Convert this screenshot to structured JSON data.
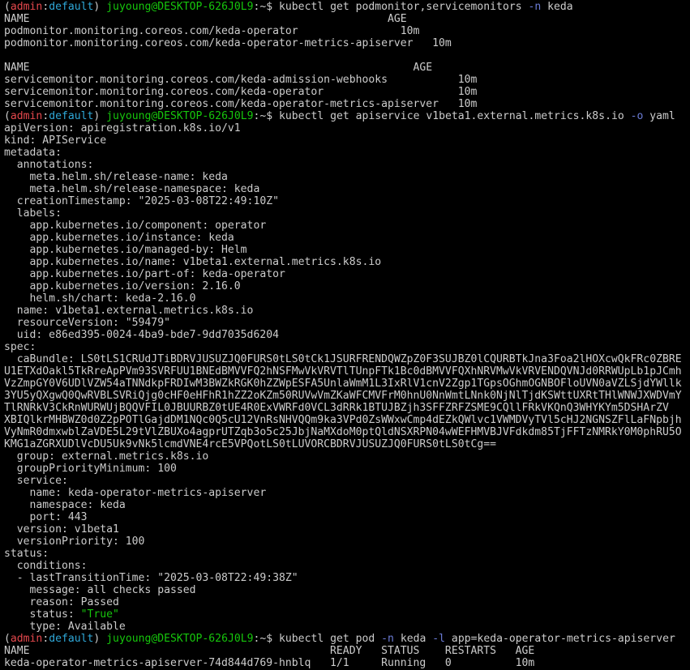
{
  "colors": {
    "background": "#000000",
    "foreground": "#cccccc",
    "prompt_env": "#e5484d",
    "prompt_ctx": "#2fa8d8",
    "prompt_user": "#16c60c",
    "flag": "#6b7cd6",
    "value_true": "#16c60c"
  },
  "lines": [
    {
      "kind": "prompt",
      "env": "admin",
      "ctx": "default",
      "userhost": "juyoung@DESKTOP-626J0L9",
      "path": ":~$ ",
      "cmd": [
        {
          "t": "kubectl get podmonitor,servicemonitors "
        },
        {
          "t": "-n",
          "c": "flag"
        },
        {
          "t": " keda"
        }
      ]
    },
    {
      "kind": "out",
      "text": "NAME                                                        AGE"
    },
    {
      "kind": "out",
      "text": "podmonitor.monitoring.coreos.com/keda-operator                10m"
    },
    {
      "kind": "out",
      "text": "podmonitor.monitoring.coreos.com/keda-operator-metrics-apiserver   10m"
    },
    {
      "kind": "out",
      "text": ""
    },
    {
      "kind": "out",
      "text": "NAME                                                            AGE"
    },
    {
      "kind": "out",
      "text": "servicemonitor.monitoring.coreos.com/keda-admission-webhooks           10m"
    },
    {
      "kind": "out",
      "text": "servicemonitor.monitoring.coreos.com/keda-operator                     10m"
    },
    {
      "kind": "out",
      "text": "servicemonitor.monitoring.coreos.com/keda-operator-metrics-apiserver   10m"
    },
    {
      "kind": "prompt",
      "env": "admin",
      "ctx": "default",
      "userhost": "juyoung@DESKTOP-626J0L9",
      "path": ":~$ ",
      "cmd": [
        {
          "t": "kubectl get apiservice v1beta1.external.metrics.k8s.io "
        },
        {
          "t": "-o",
          "c": "flag"
        },
        {
          "t": " yaml"
        }
      ]
    },
    {
      "kind": "out",
      "text": "apiVersion: apiregistration.k8s.io/v1"
    },
    {
      "kind": "out",
      "text": "kind: APIService"
    },
    {
      "kind": "out",
      "text": "metadata:"
    },
    {
      "kind": "out",
      "text": "  annotations:"
    },
    {
      "kind": "out",
      "text": "    meta.helm.sh/release-name: keda"
    },
    {
      "kind": "out",
      "text": "    meta.helm.sh/release-namespace: keda"
    },
    {
      "kind": "out",
      "text": "  creationTimestamp: \"2025-03-08T22:49:10Z\""
    },
    {
      "kind": "out",
      "text": "  labels:"
    },
    {
      "kind": "out",
      "text": "    app.kubernetes.io/component: operator"
    },
    {
      "kind": "out",
      "text": "    app.kubernetes.io/instance: keda"
    },
    {
      "kind": "out",
      "text": "    app.kubernetes.io/managed-by: Helm"
    },
    {
      "kind": "out",
      "text": "    app.kubernetes.io/name: v1beta1.external.metrics.k8s.io"
    },
    {
      "kind": "out",
      "text": "    app.kubernetes.io/part-of: keda-operator"
    },
    {
      "kind": "out",
      "text": "    app.kubernetes.io/version: 2.16.0"
    },
    {
      "kind": "out",
      "text": "    helm.sh/chart: keda-2.16.0"
    },
    {
      "kind": "out",
      "text": "  name: v1beta1.external.metrics.k8s.io"
    },
    {
      "kind": "out",
      "text": "  resourceVersion: \"59479\""
    },
    {
      "kind": "out",
      "text": "  uid: e86ed395-0024-4ba9-bde7-9dd7035d6204"
    },
    {
      "kind": "out",
      "text": "spec:"
    },
    {
      "kind": "out",
      "text": "  caBundle: LS0tLS1CRUdJTiBDRVJUSUZJQ0FURS0tLS0tCk1JSURFRENDQWZpZ0F3SUJBZ0lCQURBTkJna3Foa2lHOXcwQkFRc0ZBRE"
    },
    {
      "kind": "out",
      "text": "U1ETXdOakl5TkRreApPVm93SVRFUU1BNEdBMVVFQ2hNSFMwVkVRVTlTUnpFTk1Bc0dBMVVFQXhNRVMwVkVRVENDQVNJd0RRWUpLb1pJCmh"
    },
    {
      "kind": "out",
      "text": "VzZmpGY0V6UDlVZW54aTNNdkpFRDIwM3BWZkRGK0hZZWpESFA5UnlaWmM1L3IxRlV1cnV2Zgp1TGpsOGhmOGNBOFloUVN0aVZLSjdYWllk"
    },
    {
      "kind": "out",
      "text": "3YU5yQXgwQ0QwRVBLSVRiQjg0cHF0eHFhR1hZZ2oKZm50RUVwVmZKaWFCMVFrM0hnU0NnWmtLNnk0NjNlTjdKSWttUXRtTHlWNWJXWDVmY"
    },
    {
      "kind": "out",
      "text": "TlRNRkV3CkRnWURWUjBQQVFIL0JBUURBZ0tUE4R0ExVWRFd0VCL3dRRk1BTUJBZjh3SFFZRFZSME9CQllFRkVKQnQ3WHYKYm5DSHArZV"
    },
    {
      "kind": "out",
      "text": "XBIQlkrMHBWZ0d0Z2pPOTlGajdDM1NQc0Q5cU12VnRsNHVQQm9ka3VPd0ZsWWxwCmp4dEZkQWlvc1VWMDVyTVl5cHJ2NGNSZFlLaFNpbjh"
    },
    {
      "kind": "out",
      "text": "VyNmR0dmxwblZaVDE5L29tVlZBUXo4agprUTZqb3o5c25JbjNaMXdoM0ptQldNSXRPN04wWEFHMVBJVFdkdm85TjFFTzNMRkY0M0phRU5O"
    },
    {
      "kind": "out",
      "text": "KMG1aZGRXUDlVcDU5Uk9vNk5lcmdVNE4rcE5VPQotLS0tLUVORCBDRVJUSUZJQ0FURS0tLS0tCg=="
    },
    {
      "kind": "out",
      "text": "  group: external.metrics.k8s.io"
    },
    {
      "kind": "out",
      "text": "  groupPriorityMinimum: 100"
    },
    {
      "kind": "out",
      "text": "  service:"
    },
    {
      "kind": "out",
      "text": "    name: keda-operator-metrics-apiserver"
    },
    {
      "kind": "out",
      "text": "    namespace: keda"
    },
    {
      "kind": "out",
      "text": "    port: 443"
    },
    {
      "kind": "out",
      "text": "  version: v1beta1"
    },
    {
      "kind": "out",
      "text": "  versionPriority: 100"
    },
    {
      "kind": "out",
      "text": "status:"
    },
    {
      "kind": "out",
      "text": "  conditions:"
    },
    {
      "kind": "out",
      "text": "  - lastTransitionTime: \"2025-03-08T22:49:38Z\""
    },
    {
      "kind": "out",
      "text": "    message: all checks passed"
    },
    {
      "kind": "out",
      "text": "    reason: Passed"
    },
    {
      "kind": "kv",
      "key": "    status: ",
      "value": "\"True\""
    },
    {
      "kind": "out",
      "text": "    type: Available"
    },
    {
      "kind": "prompt",
      "env": "admin",
      "ctx": "default",
      "userhost": "juyoung@DESKTOP-626J0L9",
      "path": ":~$ ",
      "cmd": [
        {
          "t": "kubectl get pod "
        },
        {
          "t": "-n",
          "c": "flag"
        },
        {
          "t": " keda "
        },
        {
          "t": "-l",
          "c": "flag"
        },
        {
          "t": " app=keda-operator-metrics-apiserver"
        }
      ]
    },
    {
      "kind": "out",
      "text": "NAME                                               READY   STATUS    RESTARTS   AGE"
    },
    {
      "kind": "out",
      "text": "keda-operator-metrics-apiserver-74d844d769-hnblq   1/1     Running   0          10m"
    }
  ]
}
